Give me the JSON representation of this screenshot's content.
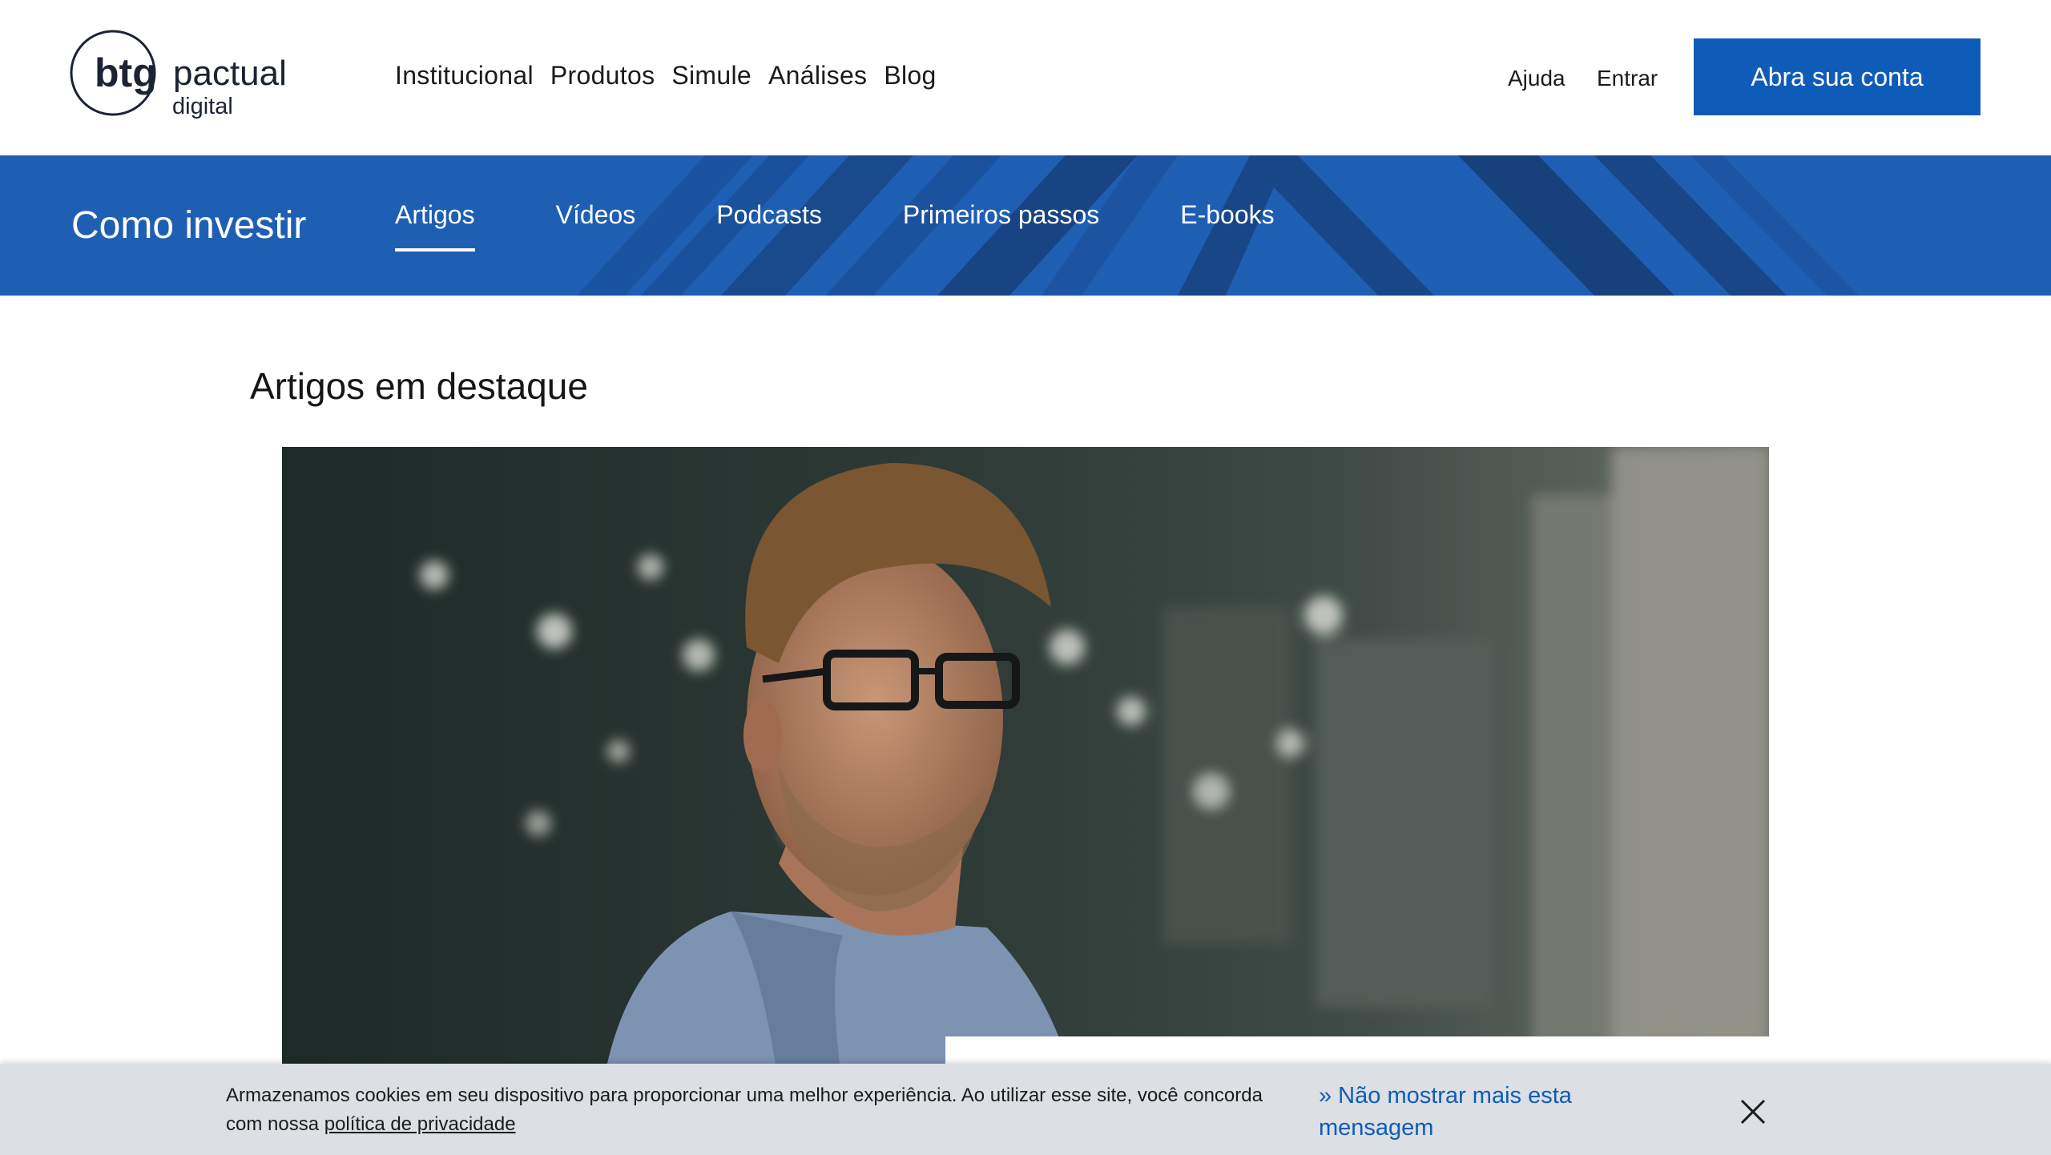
{
  "header": {
    "logo": {
      "brand": "btg",
      "name": "pactual",
      "sub": "digital"
    },
    "nav": [
      "Institucional",
      "Produtos",
      "Simule",
      "Análises",
      "Blog"
    ],
    "help_label": "Ajuda",
    "login_label": "Entrar",
    "cta_label": "Abra sua conta"
  },
  "subnav": {
    "title": "Como investir",
    "tabs": [
      {
        "label": "Artigos",
        "active": true
      },
      {
        "label": "Vídeos",
        "active": false
      },
      {
        "label": "Podcasts",
        "active": false
      },
      {
        "label": "Primeiros passos",
        "active": false
      },
      {
        "label": "E-books",
        "active": false
      }
    ]
  },
  "main": {
    "section_heading": "Artigos em destaque"
  },
  "cookie_banner": {
    "text": "Armazenamos cookies em seu dispositivo para proporcionar uma melhor experiência. Ao utilizar esse site, você concorda com nossa ",
    "policy_link": "política de privacidade",
    "dismiss_label": "» Não mostrar mais esta mensagem",
    "close_icon": "close-icon"
  },
  "colors": {
    "brand_blue": "#0f5cb8",
    "subnav_blue": "#1f5fb3",
    "banner_gray": "#dcdfe3"
  }
}
